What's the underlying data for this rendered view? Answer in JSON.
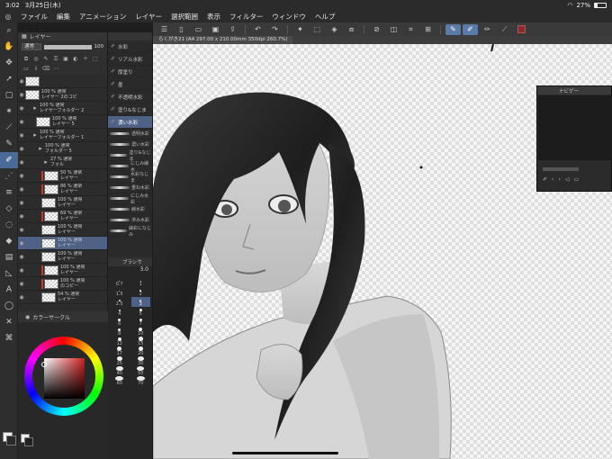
{
  "status": {
    "time": "3:02",
    "date": "3月25日(木)",
    "battery": "27%",
    "battery_level": 0.27
  },
  "menu": [
    "ファイル",
    "編集",
    "アニメーション",
    "レイヤー",
    "選択範囲",
    "表示",
    "フィルター",
    "ウィンドウ",
    "ヘルプ"
  ],
  "canvas_tab": "らくがき21 (A4 297.00 x 210.00mm 350dpi 260.7%)",
  "layer_panel": {
    "title": "レイヤー",
    "blend": "通常",
    "opacity": 100,
    "layers": [
      {
        "line1": "",
        "line2": "",
        "kind": "layer",
        "indent": 0,
        "red": false
      },
      {
        "line1": "100 % 通常",
        "line2": "レイヤー 2のコピ",
        "kind": "layer",
        "indent": 0,
        "red": false
      },
      {
        "line1": "100 % 通常",
        "line2": "レイヤーフォルダー 2",
        "kind": "folder",
        "indent": 1,
        "red": false
      },
      {
        "line1": "100 % 通常",
        "line2": "レイヤー 5",
        "kind": "layer",
        "indent": 2,
        "red": false
      },
      {
        "line1": "100 % 通常",
        "line2": "レイヤーフォルダー 1",
        "kind": "folder",
        "indent": 1,
        "red": false
      },
      {
        "line1": "100 % 通常",
        "line2": "フォルダー 5",
        "kind": "folder",
        "indent": 2,
        "red": false
      },
      {
        "line1": "27 % 通常",
        "line2": "フォル",
        "kind": "folder",
        "indent": 3,
        "red": false
      },
      {
        "line1": "50 % 通常",
        "line2": "レイヤー",
        "kind": "layer",
        "indent": 3,
        "red": true
      },
      {
        "line1": "86 % 通常",
        "line2": "レイヤー",
        "kind": "layer",
        "indent": 3,
        "red": true
      },
      {
        "line1": "100 % 通常",
        "line2": "レイヤー",
        "kind": "layer",
        "indent": 3,
        "red": false
      },
      {
        "line1": "69 % 通常",
        "line2": "レイヤー",
        "kind": "layer",
        "indent": 3,
        "red": true
      },
      {
        "line1": "100 % 通常",
        "line2": "レイヤー",
        "kind": "layer",
        "indent": 3,
        "red": false
      },
      {
        "line1": "100 % 通常",
        "line2": "レイヤー",
        "kind": "layer",
        "indent": 3,
        "red": false,
        "sel": true
      },
      {
        "line1": "100 % 通常",
        "line2": "レイヤー",
        "kind": "layer",
        "indent": 3,
        "red": false
      },
      {
        "line1": "100 % 通常",
        "line2": "レイヤー",
        "kind": "layer",
        "indent": 3,
        "red": true
      },
      {
        "line1": "100 % 通常",
        "line2": "のコピー",
        "kind": "layer",
        "indent": 3,
        "red": true
      },
      {
        "line1": "54 % 通常",
        "line2": "レイヤー",
        "kind": "layer",
        "indent": 3,
        "red": false
      }
    ]
  },
  "brushes": [
    {
      "label": "水彩",
      "sel": false
    },
    {
      "label": "リアル水彩",
      "sel": false
    },
    {
      "label": "厚塗り",
      "sel": false
    },
    {
      "label": "墨",
      "sel": false
    },
    {
      "label": "不透明水彩",
      "sel": false
    },
    {
      "label": "塗り&なじま",
      "sel": false
    },
    {
      "label": "濃い水彩",
      "sel": true
    }
  ],
  "strokes": [
    "透明水彩",
    "濃い水彩",
    "塗り&なじま",
    "にじみ縁水",
    "水彩なじま",
    "重ね水彩",
    "にじみ水彩",
    "線水彩",
    "滲み水彩",
    "縁彩になじみ"
  ],
  "brush_size": {
    "title": "ブラシサ",
    "current": "3.0",
    "sizes": [
      "0.7",
      "1",
      "1.5",
      "2",
      "2.5",
      "3",
      "4",
      "5",
      "6",
      "7",
      "8",
      "10",
      "12",
      "15",
      "17",
      "20",
      "25",
      "30",
      "40",
      "50",
      "60",
      "70"
    ],
    "selected": "3"
  },
  "color_panel": {
    "title": "カラーサークル"
  },
  "navigator": {
    "title": "ナビゲー"
  }
}
